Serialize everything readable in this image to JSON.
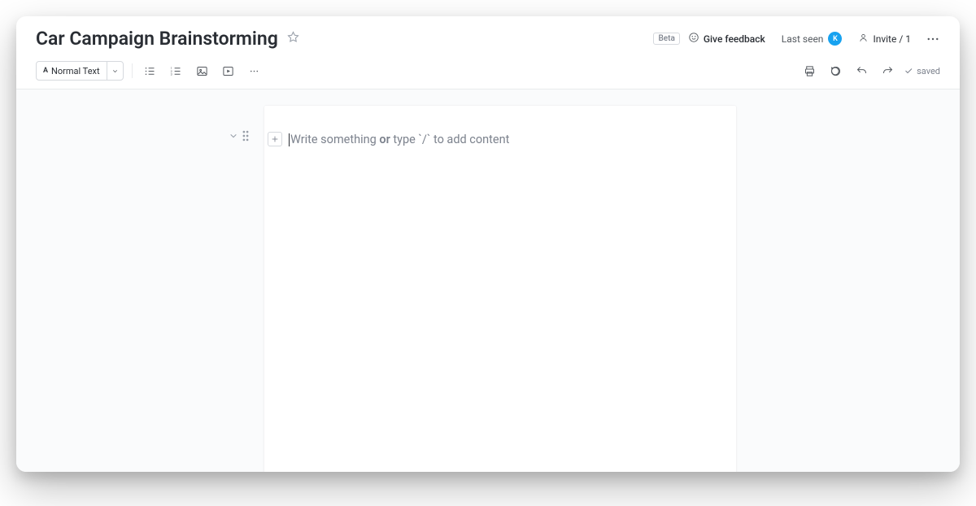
{
  "header": {
    "title": "Car Campaign Brainstorming",
    "beta_label": "Beta",
    "feedback_label": "Give feedback",
    "last_seen_label": "Last seen",
    "avatar_initial": "K",
    "invite_label": "Invite / 1"
  },
  "toolbar": {
    "format_label": "Normal Text",
    "saved_label": "saved"
  },
  "editor": {
    "placeholder_pre": "Write something ",
    "placeholder_bold": "or",
    "placeholder_post": " type `/` to add content"
  }
}
